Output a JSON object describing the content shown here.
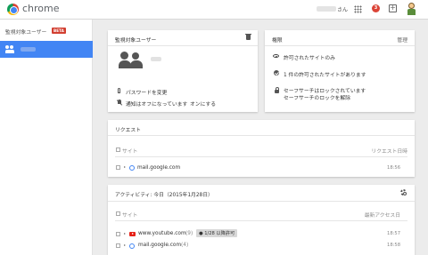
{
  "header": {
    "brand": "chrome",
    "user_suffix": "さん",
    "notification_count": "3"
  },
  "sidebar": {
    "title": "監視対象ユーザー",
    "beta_badge": "BETA"
  },
  "supervised_card": {
    "title": "監視対象ユーザー",
    "change_password": "パスワードを変更",
    "notifications_text": "通知はオフになっています",
    "turn_on_link": "オンにする"
  },
  "permissions_card": {
    "title": "権限",
    "manage_link": "管理",
    "items": [
      {
        "text": "許可されたサイトのみ"
      },
      {
        "text": "1 件の許可されたサイトがあります"
      },
      {
        "text": "セーフサーチはロックされています",
        "link": "セーフサーチのロックを解除"
      }
    ]
  },
  "requests_card": {
    "title": "リクエスト",
    "col_site": "サイト",
    "col_date": "リクエスト日時",
    "rows": [
      {
        "site": "mail.google.com",
        "time": "18:56"
      }
    ]
  },
  "activity_card": {
    "title": "アクティビティ: 今日（2015年1月28日）",
    "col_site": "サイト",
    "col_date": "最新アクセス日",
    "rows": [
      {
        "site": "www.youtube.com",
        "count": "(9)",
        "badge": "1/28 以降許可",
        "time": "18:57"
      },
      {
        "site": "mail.google.com",
        "count": "(4)",
        "time": "18:58"
      }
    ]
  }
}
